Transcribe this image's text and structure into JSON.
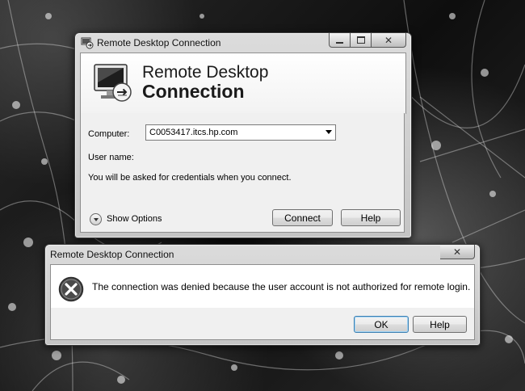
{
  "main_window": {
    "title": "Remote Desktop Connection",
    "banner_line1": "Remote Desktop",
    "banner_line2": "Connection",
    "computer_label": "Computer:",
    "computer_value": "C0053417.itcs.hp.com",
    "username_label": "User name:",
    "info_text": "You will be asked for credentials when you connect.",
    "show_options_label": "Show Options",
    "connect_label": "Connect",
    "help_label": "Help"
  },
  "error_dialog": {
    "title": "Remote Desktop Connection",
    "message": "The connection was denied because the user account is not authorized for remote login.",
    "ok_label": "OK",
    "help_label": "Help"
  },
  "icons": {
    "app_icon": "remote-desktop-icon",
    "monitor_icon": "monitor-icon",
    "error_icon": "error-x-icon",
    "expand_icon": "chevron-down-circle-icon"
  }
}
